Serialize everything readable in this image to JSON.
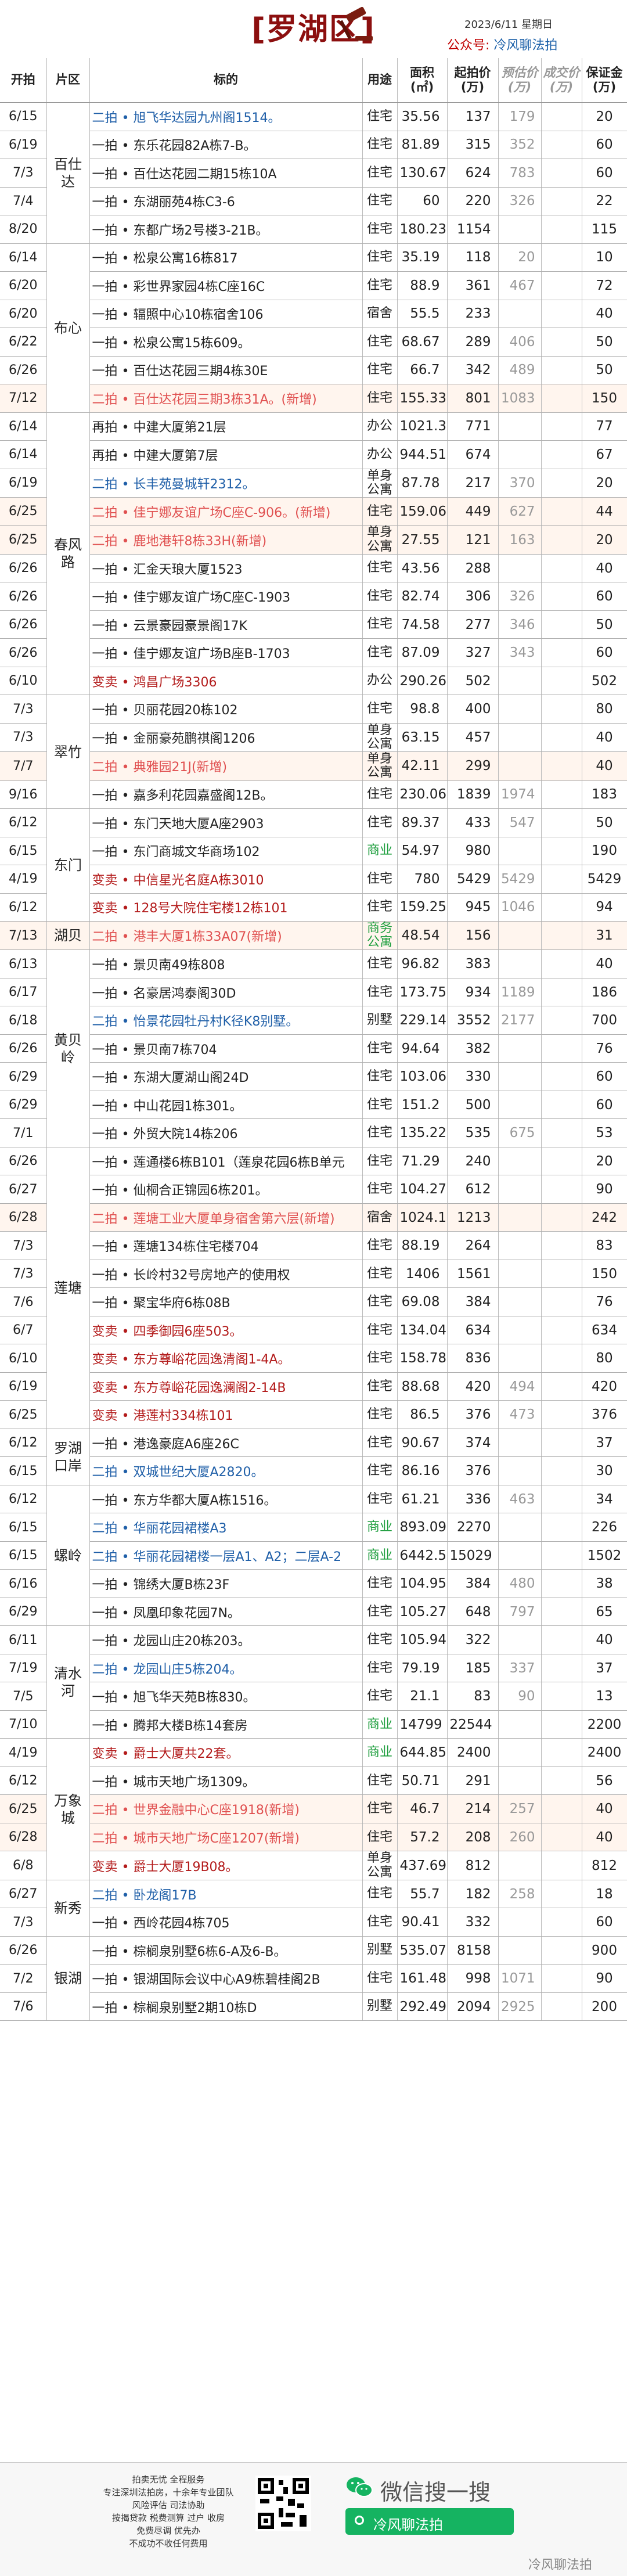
{
  "header": {
    "title": "[罗湖区]",
    "date": "2023/6/11 星期日",
    "account_label": "公众号:",
    "account_name": "冷风聊法拍"
  },
  "columns": [
    "开拍",
    "片区",
    "标的",
    "用途",
    "面积 (㎡)",
    "起拍价 (万)",
    "预估价 (万)",
    "成交价 (万)",
    "保证金 (万)"
  ],
  "rows": [
    {
      "date": "6/15",
      "area": "百仕达",
      "name": "二拍 • 旭飞华达园九州阁1514。",
      "use": "住宅",
      "size": "35.56",
      "start": "137",
      "pv": "179",
      "cv": "",
      "dep": "20",
      "style": "second"
    },
    {
      "date": "6/19",
      "area": "",
      "name": "一拍 • 东乐花园82A栋7-B。",
      "use": "住宅",
      "size": "81.89",
      "start": "315",
      "pv": "352",
      "cv": "",
      "dep": "60",
      "style": ""
    },
    {
      "date": "7/3",
      "area": "",
      "name": "一拍 • 百仕达花园二期15栋10A",
      "use": "住宅",
      "size": "130.67",
      "start": "624",
      "pv": "783",
      "cv": "",
      "dep": "60",
      "style": ""
    },
    {
      "date": "7/4",
      "area": "",
      "name": "一拍 • 东湖丽苑4栋C3-6",
      "use": "住宅",
      "size": "60",
      "start": "220",
      "pv": "326",
      "cv": "",
      "dep": "22",
      "style": ""
    },
    {
      "date": "8/20",
      "area": "",
      "name": "一拍 • 东都广场2号楼3-21B。",
      "use": "住宅",
      "size": "180.23",
      "start": "1154",
      "pv": "",
      "cv": "",
      "dep": "115",
      "style": ""
    },
    {
      "date": "6/14",
      "area": "布心",
      "name": "一拍 • 松泉公寓16栋817",
      "use": "住宅",
      "size": "35.19",
      "start": "118",
      "pv": "20",
      "cv": "",
      "dep": "10",
      "style": ""
    },
    {
      "date": "6/20",
      "area": "",
      "name": "一拍 • 彩世界家园4栋C座16C",
      "use": "住宅",
      "size": "88.9",
      "start": "361",
      "pv": "467",
      "cv": "",
      "dep": "72",
      "style": ""
    },
    {
      "date": "6/20",
      "area": "",
      "name": "一拍 • 辐照中心10栋宿舍106",
      "use": "宿舍",
      "size": "55.5",
      "start": "233",
      "pv": "",
      "cv": "",
      "dep": "40",
      "style": ""
    },
    {
      "date": "6/22",
      "area": "",
      "name": "一拍 • 松泉公寓15栋609。",
      "use": "住宅",
      "size": "68.67",
      "start": "289",
      "pv": "406",
      "cv": "",
      "dep": "50",
      "style": ""
    },
    {
      "date": "6/26",
      "area": "",
      "name": "一拍 • 百仕达花园三期4栋30E",
      "use": "住宅",
      "size": "66.7",
      "start": "342",
      "pv": "489",
      "cv": "",
      "dep": "50",
      "style": ""
    },
    {
      "date": "7/12",
      "area": "",
      "name": "二拍 • 百仕达花园三期3栋31A。(新增)",
      "use": "住宅",
      "size": "155.33",
      "start": "801",
      "pv": "1083",
      "cv": "",
      "dep": "150",
      "style": "newadd"
    },
    {
      "date": "6/14",
      "area": "春风路",
      "name": "再拍 • 中建大厦第21层",
      "use": "办公",
      "size": "1021.3",
      "start": "771",
      "pv": "",
      "cv": "",
      "dep": "77",
      "style": ""
    },
    {
      "date": "6/14",
      "area": "",
      "name": "再拍 • 中建大厦第7层",
      "use": "办公",
      "size": "944.51",
      "start": "674",
      "pv": "",
      "cv": "",
      "dep": "67",
      "style": ""
    },
    {
      "date": "6/19",
      "area": "",
      "name": "二拍 • 长丰苑曼城轩2312。",
      "use": "单身公寓",
      "size": "87.78",
      "start": "217",
      "pv": "370",
      "cv": "",
      "dep": "20",
      "style": "second"
    },
    {
      "date": "6/25",
      "area": "",
      "name": "二拍 • 佳宁娜友谊广场C座C-906。(新增)",
      "use": "住宅",
      "size": "159.06",
      "start": "449",
      "pv": "627",
      "cv": "",
      "dep": "44",
      "style": "newadd"
    },
    {
      "date": "6/25",
      "area": "",
      "name": "二拍 • 鹿地港轩8栋33H(新增)",
      "use": "单身公寓",
      "size": "27.55",
      "start": "121",
      "pv": "163",
      "cv": "",
      "dep": "20",
      "style": "newadd"
    },
    {
      "date": "6/26",
      "area": "",
      "name": "一拍 • 汇金天琅大厦1523",
      "use": "住宅",
      "size": "43.56",
      "start": "288",
      "pv": "",
      "cv": "",
      "dep": "40",
      "style": ""
    },
    {
      "date": "6/26",
      "area": "",
      "name": "一拍 • 佳宁娜友谊广场C座C-1903",
      "use": "住宅",
      "size": "82.74",
      "start": "306",
      "pv": "326",
      "cv": "",
      "dep": "60",
      "style": ""
    },
    {
      "date": "6/26",
      "area": "",
      "name": "一拍 • 云景豪园豪景阁17K",
      "use": "住宅",
      "size": "74.58",
      "start": "277",
      "pv": "346",
      "cv": "",
      "dep": "50",
      "style": ""
    },
    {
      "date": "6/26",
      "area": "",
      "name": "一拍 • 佳宁娜友谊广场B座B-1703",
      "use": "住宅",
      "size": "87.09",
      "start": "327",
      "pv": "343",
      "cv": "",
      "dep": "60",
      "style": ""
    },
    {
      "date": "6/10",
      "area": "",
      "name": "变卖 • 鸿昌广场3306",
      "use": "办公",
      "size": "290.26",
      "start": "502",
      "pv": "",
      "cv": "",
      "dep": "502",
      "style": "change"
    },
    {
      "date": "7/3",
      "area": "翠竹",
      "name": "一拍 • 贝丽花园20栋102",
      "use": "住宅",
      "size": "98.8",
      "start": "400",
      "pv": "",
      "cv": "",
      "dep": "80",
      "style": ""
    },
    {
      "date": "7/3",
      "area": "",
      "name": "一拍 • 金丽豪苑鹏祺阁1206",
      "use": "单身公寓",
      "size": "63.15",
      "start": "457",
      "pv": "",
      "cv": "",
      "dep": "40",
      "style": ""
    },
    {
      "date": "7/7",
      "area": "",
      "name": "二拍 • 典雅园21J(新增)",
      "use": "单身公寓",
      "size": "42.11",
      "start": "299",
      "pv": "",
      "cv": "",
      "dep": "40",
      "style": "newadd"
    },
    {
      "date": "9/16",
      "area": "",
      "name": "一拍 • 嘉多利花园嘉盛阁12B。",
      "use": "住宅",
      "size": "230.06",
      "start": "1839",
      "pv": "1974",
      "cv": "",
      "dep": "183",
      "style": ""
    },
    {
      "date": "6/12",
      "area": "东门",
      "name": "一拍 • 东门天地大厦A座2903",
      "use": "住宅",
      "size": "89.37",
      "start": "433",
      "pv": "547",
      "cv": "",
      "dep": "50",
      "style": ""
    },
    {
      "date": "6/15",
      "area": "",
      "name": "一拍 • 东门商城文华商场102",
      "use": "商业",
      "size": "54.97",
      "start": "980",
      "pv": "",
      "cv": "",
      "dep": "190",
      "style": "commercial"
    },
    {
      "date": "4/19",
      "area": "",
      "name": "变卖 • 中信星光名庭A栋3010",
      "use": "住宅",
      "size": "780",
      "start": "5429",
      "pv": "5429",
      "cv": "",
      "dep": "5429",
      "style": "change"
    },
    {
      "date": "6/12",
      "area": "",
      "name": "变卖 • 128号大院住宅楼12栋101",
      "use": "住宅",
      "size": "159.25",
      "start": "945",
      "pv": "1046",
      "cv": "",
      "dep": "94",
      "style": "change"
    },
    {
      "date": "7/13",
      "area": "湖贝",
      "name": "二拍 • 港丰大厦1栋33A07(新增)",
      "use": "商务公寓",
      "size": "48.54",
      "start": "156",
      "pv": "",
      "cv": "",
      "dep": "31",
      "style": "newadd commercial"
    },
    {
      "date": "6/13",
      "area": "黄贝岭",
      "name": "一拍 • 景贝南49栋808",
      "use": "住宅",
      "size": "96.82",
      "start": "383",
      "pv": "",
      "cv": "",
      "dep": "40",
      "style": ""
    },
    {
      "date": "6/17",
      "area": "",
      "name": "一拍 • 名豪居鸿泰阁30D",
      "use": "住宅",
      "size": "173.75",
      "start": "934",
      "pv": "1189",
      "cv": "",
      "dep": "186",
      "style": ""
    },
    {
      "date": "6/18",
      "area": "",
      "name": "二拍 • 怡景花园牡丹村K径K8别墅。",
      "use": "别墅",
      "size": "229.14",
      "start": "3552",
      "pv": "2177",
      "cv": "",
      "dep": "700",
      "style": "second"
    },
    {
      "date": "6/26",
      "area": "",
      "name": "一拍 • 景贝南7栋704",
      "use": "住宅",
      "size": "94.64",
      "start": "382",
      "pv": "",
      "cv": "",
      "dep": "76",
      "style": ""
    },
    {
      "date": "6/29",
      "area": "",
      "name": "一拍 • 东湖大厦湖山阁24D",
      "use": "住宅",
      "size": "103.06",
      "start": "330",
      "pv": "",
      "cv": "",
      "dep": "60",
      "style": ""
    },
    {
      "date": "6/29",
      "area": "",
      "name": "一拍 • 中山花园1栋301。",
      "use": "住宅",
      "size": "151.2",
      "start": "500",
      "pv": "",
      "cv": "",
      "dep": "60",
      "style": ""
    },
    {
      "date": "7/1",
      "area": "",
      "name": "一拍 • 外贸大院14栋206",
      "use": "住宅",
      "size": "135.22",
      "start": "535",
      "pv": "675",
      "cv": "",
      "dep": "53",
      "style": ""
    },
    {
      "date": "6/26",
      "area": "莲塘",
      "name": "一拍 • 莲通楼6栋B101（莲泉花园6栋B单元",
      "use": "住宅",
      "size": "71.29",
      "start": "240",
      "pv": "",
      "cv": "",
      "dep": "20",
      "style": ""
    },
    {
      "date": "6/27",
      "area": "",
      "name": "一拍 • 仙桐合正锦园6栋201。",
      "use": "住宅",
      "size": "104.27",
      "start": "612",
      "pv": "",
      "cv": "",
      "dep": "90",
      "style": ""
    },
    {
      "date": "6/28",
      "area": "",
      "name": "二拍 • 莲塘工业大厦单身宿舍第六层(新增)",
      "use": "宿舍",
      "size": "1024.1",
      "start": "1213",
      "pv": "",
      "cv": "",
      "dep": "242",
      "style": "newadd"
    },
    {
      "date": "7/3",
      "area": "",
      "name": "一拍 • 莲塘134栋住宅楼704",
      "use": "住宅",
      "size": "88.19",
      "start": "264",
      "pv": "",
      "cv": "",
      "dep": "83",
      "style": ""
    },
    {
      "date": "7/3",
      "area": "",
      "name": "一拍 • 长岭村32号房地产的使用权",
      "use": "住宅",
      "size": "1406",
      "start": "1561",
      "pv": "",
      "cv": "",
      "dep": "150",
      "style": ""
    },
    {
      "date": "7/6",
      "area": "",
      "name": "一拍 • 聚宝华府6栋08B",
      "use": "住宅",
      "size": "69.08",
      "start": "384",
      "pv": "",
      "cv": "",
      "dep": "76",
      "style": ""
    },
    {
      "date": "6/7",
      "area": "",
      "name": "变卖 • 四季御园6座503。",
      "use": "住宅",
      "size": "134.04",
      "start": "634",
      "pv": "",
      "cv": "",
      "dep": "634",
      "style": "change"
    },
    {
      "date": "6/10",
      "area": "",
      "name": "变卖 • 东方尊峪花园逸清阁1-4A。",
      "use": "住宅",
      "size": "158.78",
      "start": "836",
      "pv": "",
      "cv": "",
      "dep": "80",
      "style": "change"
    },
    {
      "date": "6/19",
      "area": "",
      "name": "变卖 • 东方尊峪花园逸澜阁2-14B",
      "use": "住宅",
      "size": "88.68",
      "start": "420",
      "pv": "494",
      "cv": "",
      "dep": "420",
      "style": "change"
    },
    {
      "date": "6/25",
      "area": "",
      "name": "变卖 • 港莲村334栋101",
      "use": "住宅",
      "size": "86.5",
      "start": "376",
      "pv": "473",
      "cv": "",
      "dep": "376",
      "style": "change"
    },
    {
      "date": "6/12",
      "area": "罗湖口岸",
      "name": "一拍 • 港逸豪庭A6座26C",
      "use": "住宅",
      "size": "90.67",
      "start": "374",
      "pv": "",
      "cv": "",
      "dep": "37",
      "style": ""
    },
    {
      "date": "6/15",
      "area": "",
      "name": "二拍 • 双城世纪大厦A2820。",
      "use": "住宅",
      "size": "86.16",
      "start": "376",
      "pv": "",
      "cv": "",
      "dep": "30",
      "style": "second"
    },
    {
      "date": "6/12",
      "area": "螺岭",
      "name": "一拍 • 东方华都大厦A栋1516。",
      "use": "住宅",
      "size": "61.21",
      "start": "336",
      "pv": "463",
      "cv": "",
      "dep": "34",
      "style": ""
    },
    {
      "date": "6/15",
      "area": "",
      "name": "二拍 • 华丽花园裙楼A3",
      "use": "商业",
      "size": "893.09",
      "start": "2270",
      "pv": "",
      "cv": "",
      "dep": "226",
      "style": "second commercial"
    },
    {
      "date": "6/15",
      "area": "",
      "name": "二拍 • 华丽花园裙楼一层A1、A2；二层A-2",
      "use": "商业",
      "size": "6442.5",
      "start": "15029",
      "pv": "",
      "cv": "",
      "dep": "1502",
      "style": "second commercial"
    },
    {
      "date": "6/16",
      "area": "",
      "name": "一拍 • 锦绣大厦B栋23F",
      "use": "住宅",
      "size": "104.95",
      "start": "384",
      "pv": "480",
      "cv": "",
      "dep": "38",
      "style": ""
    },
    {
      "date": "6/29",
      "area": "",
      "name": "一拍 • 凤凰印象花园7N。",
      "use": "住宅",
      "size": "105.27",
      "start": "648",
      "pv": "797",
      "cv": "",
      "dep": "65",
      "style": ""
    },
    {
      "date": "6/11",
      "area": "清水河",
      "name": "一拍 • 龙园山庄20栋203。",
      "use": "住宅",
      "size": "105.94",
      "start": "322",
      "pv": "",
      "cv": "",
      "dep": "40",
      "style": ""
    },
    {
      "date": "7/19",
      "area": "",
      "name": "二拍 • 龙园山庄5栋204。",
      "use": "住宅",
      "size": "79.19",
      "start": "185",
      "pv": "337",
      "cv": "",
      "dep": "37",
      "style": "second"
    },
    {
      "date": "7/5",
      "area": "",
      "name": "一拍 • 旭飞华天苑B栋830。",
      "use": "住宅",
      "size": "21.1",
      "start": "83",
      "pv": "90",
      "cv": "",
      "dep": "13",
      "style": ""
    },
    {
      "date": "7/10",
      "area": "",
      "name": "一拍 • 腾邦大楼B栋14套房",
      "use": "商业",
      "size": "14799",
      "start": "22544",
      "pv": "",
      "cv": "",
      "dep": "2200",
      "style": "commercial"
    },
    {
      "date": "4/19",
      "area": "万象城",
      "name": "变卖 • 爵士大厦共22套。",
      "use": "商业",
      "size": "644.85",
      "start": "2400",
      "pv": "",
      "cv": "",
      "dep": "2400",
      "style": "change commercial"
    },
    {
      "date": "6/12",
      "area": "",
      "name": "一拍 • 城市天地广场1309。",
      "use": "住宅",
      "size": "50.71",
      "start": "291",
      "pv": "",
      "cv": "",
      "dep": "56",
      "style": ""
    },
    {
      "date": "6/25",
      "area": "",
      "name": "二拍 • 世界金融中心C座1918(新增)",
      "use": "住宅",
      "size": "46.7",
      "start": "214",
      "pv": "257",
      "cv": "",
      "dep": "40",
      "style": "newadd"
    },
    {
      "date": "6/28",
      "area": "",
      "name": "二拍 • 城市天地广场C座1207(新增)",
      "use": "住宅",
      "size": "57.2",
      "start": "208",
      "pv": "260",
      "cv": "",
      "dep": "40",
      "style": "newadd"
    },
    {
      "date": "6/8",
      "area": "",
      "name": "变卖 • 爵士大厦19B08。",
      "use": "单身公寓",
      "size": "437.69",
      "start": "812",
      "pv": "",
      "cv": "",
      "dep": "812",
      "style": "change"
    },
    {
      "date": "6/27",
      "area": "新秀",
      "name": "二拍 • 卧龙阁17B",
      "use": "住宅",
      "size": "55.7",
      "start": "182",
      "pv": "258",
      "cv": "",
      "dep": "18",
      "style": "second"
    },
    {
      "date": "7/3",
      "area": "",
      "name": "一拍 • 西岭花园4栋705",
      "use": "住宅",
      "size": "90.41",
      "start": "332",
      "pv": "",
      "cv": "",
      "dep": "60",
      "style": ""
    },
    {
      "date": "6/26",
      "area": "银湖",
      "name": "一拍 • 棕榈泉别墅6栋6-A及6-B。",
      "use": "别墅",
      "size": "535.07",
      "start": "8158",
      "pv": "",
      "cv": "",
      "dep": "900",
      "style": ""
    },
    {
      "date": "7/2",
      "area": "",
      "name": "一拍 • 银湖国际会议中心A9栋碧桂阁2B",
      "use": "住宅",
      "size": "161.48",
      "start": "998",
      "pv": "1071",
      "cv": "",
      "dep": "90",
      "style": ""
    },
    {
      "date": "7/6",
      "area": "",
      "name": "一拍 • 棕榈泉别墅2期10栋D",
      "use": "别墅",
      "size": "292.49",
      "start": "2094",
      "pv": "2925",
      "cv": "",
      "dep": "200",
      "style": ""
    }
  ],
  "footer": {
    "lines": [
      "拍卖无忧 全程服务",
      "专注深圳法拍房，十余年专业团队",
      "风险评估 司法协助",
      "按揭贷款 税费测算 过户 收房",
      "免费尽调 优先办",
      "不成功不收任何费用"
    ],
    "wechat_text": "微信搜一搜",
    "search_name": "冷风聊法拍",
    "watermark": "冷风聊法拍"
  },
  "areas": [
    {
      "name": "百仕达",
      "rows": 5
    },
    {
      "name": "布心",
      "rows": 6
    },
    {
      "name": "春风路",
      "rows": 10
    },
    {
      "name": "翠竹",
      "rows": 4
    },
    {
      "name": "东门",
      "rows": 4
    },
    {
      "name": "湖贝",
      "rows": 1
    },
    {
      "name": "黄贝岭",
      "rows": 7
    },
    {
      "name": "莲塘",
      "rows": 10
    },
    {
      "name": "罗湖口岸",
      "rows": 2
    },
    {
      "name": "螺岭",
      "rows": 5
    },
    {
      "name": "清水河",
      "rows": 4
    },
    {
      "name": "万象城",
      "rows": 5
    },
    {
      "name": "新秀",
      "rows": 2
    },
    {
      "name": "银湖",
      "rows": 3
    }
  ]
}
